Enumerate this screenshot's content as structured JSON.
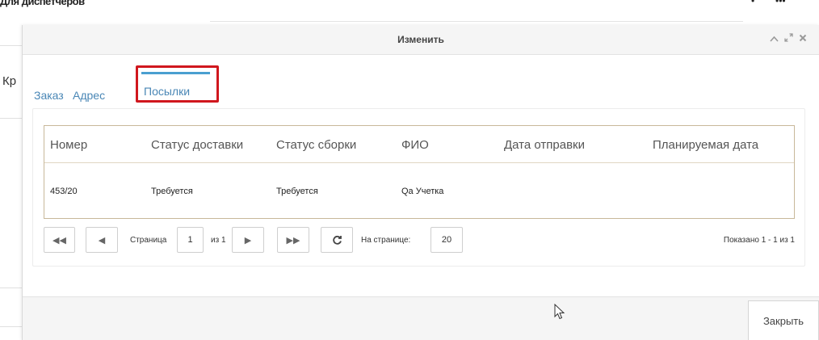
{
  "background": {
    "top_left_text": "Для диспетчеров",
    "top_right_left": "•",
    "top_right_right": "•••",
    "side_label": "Кр"
  },
  "modal": {
    "title": "Изменить",
    "header_icons": [
      "chevron-up-icon",
      "expand-icon",
      "close-icon"
    ],
    "tabs": [
      {
        "label": "Заказ",
        "active": false
      },
      {
        "label": "Адрес",
        "active": false
      },
      {
        "label": "Посылки",
        "active": true
      }
    ],
    "grid": {
      "columns": [
        "Номер",
        "Статус доставки",
        "Статус сборки",
        "ФИО",
        "Дата отправки",
        "Планируемая дата"
      ],
      "rows": [
        [
          "453/20",
          "Требуется",
          "Требуется",
          "Qa Учетка",
          "",
          ""
        ]
      ]
    },
    "pager": {
      "page_label": "Страница",
      "page_value": "1",
      "of_label": "из 1",
      "per_page_label": "На странице:",
      "per_page_value": "20",
      "info": "Показано 1 - 1 из 1"
    },
    "footer": {
      "close_label": "Закрыть"
    }
  },
  "colors": {
    "accent": "#4a87b6",
    "tab_bar": "#4a9fd0",
    "highlight": "#d0171e",
    "grid_border": "#c8b89a"
  }
}
